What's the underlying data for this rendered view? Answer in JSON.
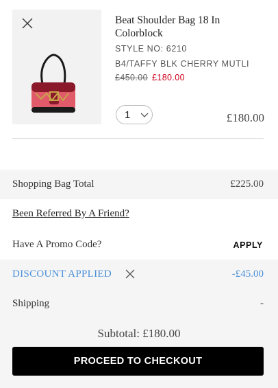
{
  "item": {
    "name": "Beat Shoulder Bag 18 In Colorblock",
    "style_no": "STYLE NO: 6210",
    "color": "B4/TAFFY BLK CHERRY MUTLI",
    "original_price": "£450.00",
    "sale_price": "£180.00",
    "quantity": "1",
    "line_total": "£180.00",
    "icons": {
      "remove": "close-icon",
      "quantity": "chevron-down-icon"
    }
  },
  "summary": {
    "bag_total_label": "Shopping Bag Total",
    "bag_total_value": "£225.00",
    "referred_link": "Been Referred By A Friend?",
    "promo_label": "Have A Promo Code?",
    "apply_label": "APPLY",
    "discount_label": "DISCOUNT APPLIED",
    "discount_value": "-£45.00",
    "shipping_label": "Shipping",
    "shipping_value": "-",
    "subtotal": "Subtotal: £180.00",
    "checkout_label": "PROCEED TO CHECKOUT"
  },
  "colors": {
    "sale_red": "#d0021b",
    "discount_blue": "#4a90d9",
    "checkout_bg": "#000000"
  }
}
